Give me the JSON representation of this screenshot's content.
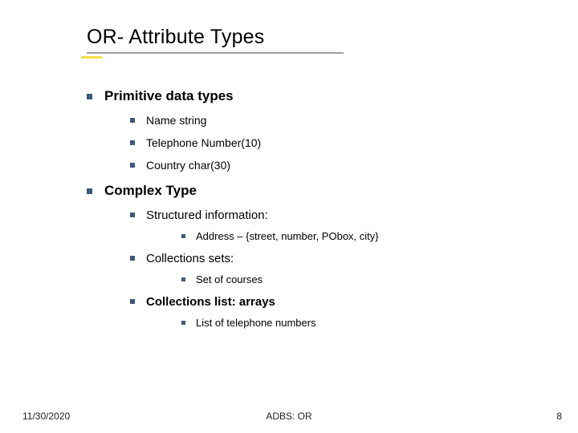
{
  "title": "OR- Attribute Types",
  "sections": [
    {
      "heading": "Primitive data types",
      "items": [
        "Name string",
        "Telephone Number(10)",
        "Country char(30)"
      ]
    },
    {
      "heading": "Complex Type",
      "subsections": [
        {
          "heading": "Structured information:",
          "items": [
            "Address – {street, number, PObox, city}"
          ]
        },
        {
          "heading": "Collections sets:",
          "items": [
            "Set of courses"
          ]
        },
        {
          "heading": "Collections list: arrays",
          "items": [
            "List of telephone numbers"
          ]
        }
      ]
    }
  ],
  "footer": {
    "date": "11/30/2020",
    "center": "ADBS: OR",
    "page": "8"
  }
}
